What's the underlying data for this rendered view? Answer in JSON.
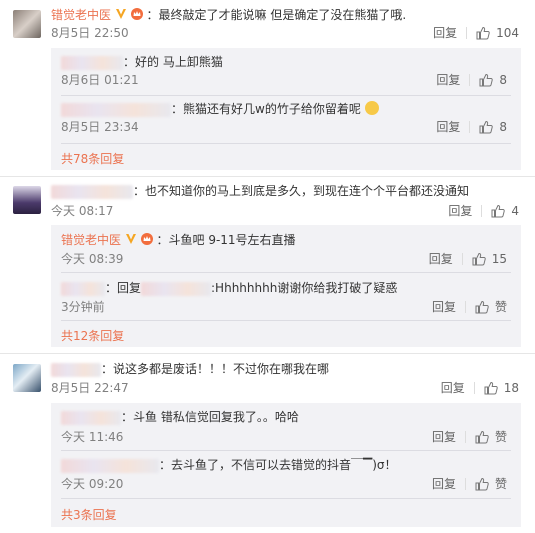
{
  "threads": [
    {
      "author": "错觉老中医",
      "text": "：最终敲定了才能说嘛 但是确定了没在熊猫了哦.",
      "time": "8月5日 22:50",
      "reply": "回复",
      "likes": "104",
      "more": "共78条回复",
      "subs": [
        {
          "text": "：好的 马上卸熊猫",
          "time": "8月6日 01:21",
          "reply": "回复",
          "likes": "8"
        },
        {
          "text": "：熊猫还有好几w的竹子给你留着呢",
          "time": "8月5日 23:34",
          "reply": "回复",
          "likes": "8"
        }
      ]
    },
    {
      "text": "：也不知道你的马上到底是多久，到现在连个个平台都还没通知",
      "time": "今天 08:17",
      "reply": "回复",
      "likes": "4",
      "more": "共12条回复",
      "subs": [
        {
          "author": "错觉老中医",
          "text": "：斗鱼吧 9-11号左右直播",
          "time": "今天 08:39",
          "reply": "回复",
          "likes": "15"
        },
        {
          "prefix": "：回复",
          "text": ":Hhhhhhhh谢谢你给我打破了疑惑",
          "time": "3分钟前",
          "reply": "回复",
          "likes": "赞"
        }
      ]
    },
    {
      "text": "：说这多都是废话！！！不过你在哪我在哪",
      "time": "8月5日 22:47",
      "reply": "回复",
      "likes": "18",
      "more": "共3条回复",
      "subs": [
        {
          "text": "：斗鱼  错私信觉回复我了。。哈哈",
          "time": "今天 11:46",
          "reply": "回复",
          "likes": "赞"
        },
        {
          "text": "：去斗鱼了，不信可以去错觉的抖音￣▔)σ！",
          "time": "今天 09:20",
          "reply": "回复",
          "likes": "赞"
        }
      ]
    }
  ],
  "colors": {
    "accent": "#eb7350",
    "meta": "#808080",
    "subbg": "#f2f2f5"
  },
  "icons": {
    "like": "thumb-up-icon",
    "verified": "v-badge-icon",
    "crown": "crown-badge-icon",
    "emoji": "smiley-emoji-icon"
  }
}
